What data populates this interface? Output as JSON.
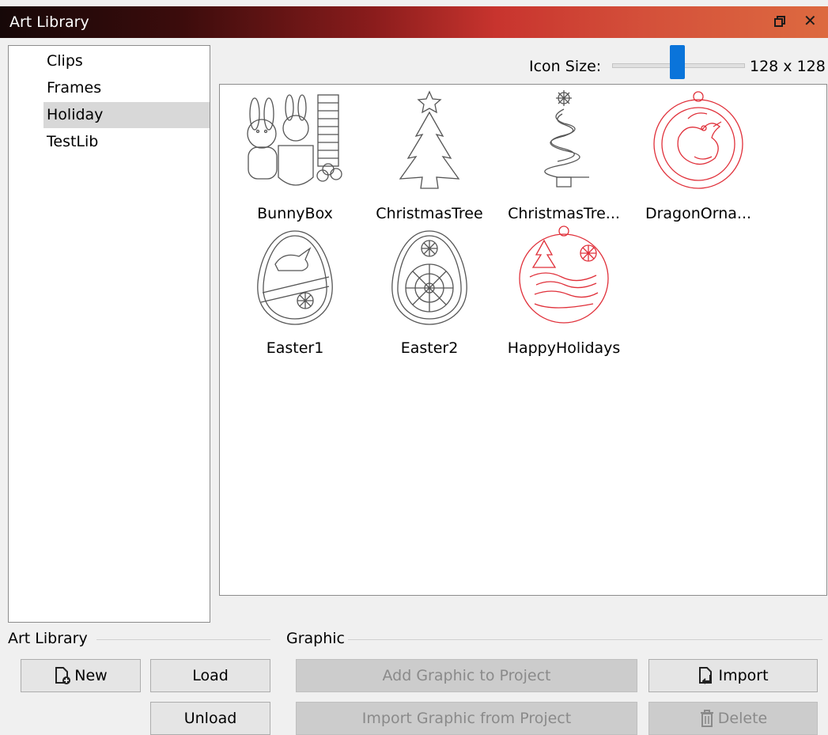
{
  "window": {
    "title": "Art Library",
    "restore_icon": "restore-icon",
    "close_icon": "close-icon"
  },
  "libraries": {
    "items": [
      "Clips",
      "Frames",
      "Holiday",
      "TestLib"
    ],
    "selected": "Holiday"
  },
  "icon_size": {
    "label": "Icon Size:",
    "value": "128 x 128"
  },
  "graphics": [
    {
      "name": "BunnyBox",
      "color": "#555555"
    },
    {
      "name": "ChristmasTree",
      "color": "#555555"
    },
    {
      "name": "ChristmasTre...",
      "color": "#555555"
    },
    {
      "name": "DragonOrna...",
      "color": "#e0303a"
    },
    {
      "name": "Easter1",
      "color": "#555555"
    },
    {
      "name": "Easter2",
      "color": "#555555"
    },
    {
      "name": "HappyHolidays",
      "color": "#e0303a"
    }
  ],
  "art_library_group": {
    "label": "Art Library",
    "new": "New",
    "load": "Load",
    "unload": "Unload"
  },
  "graphic_group": {
    "label": "Graphic",
    "add": "Add Graphic to Project",
    "import_from": "Import Graphic from Project",
    "import": "Import",
    "delete": "Delete"
  },
  "colors": {
    "accent": "#0a74da",
    "title_start": "#160808",
    "title_end": "#dd6a40",
    "red_outline": "#e0303a"
  }
}
